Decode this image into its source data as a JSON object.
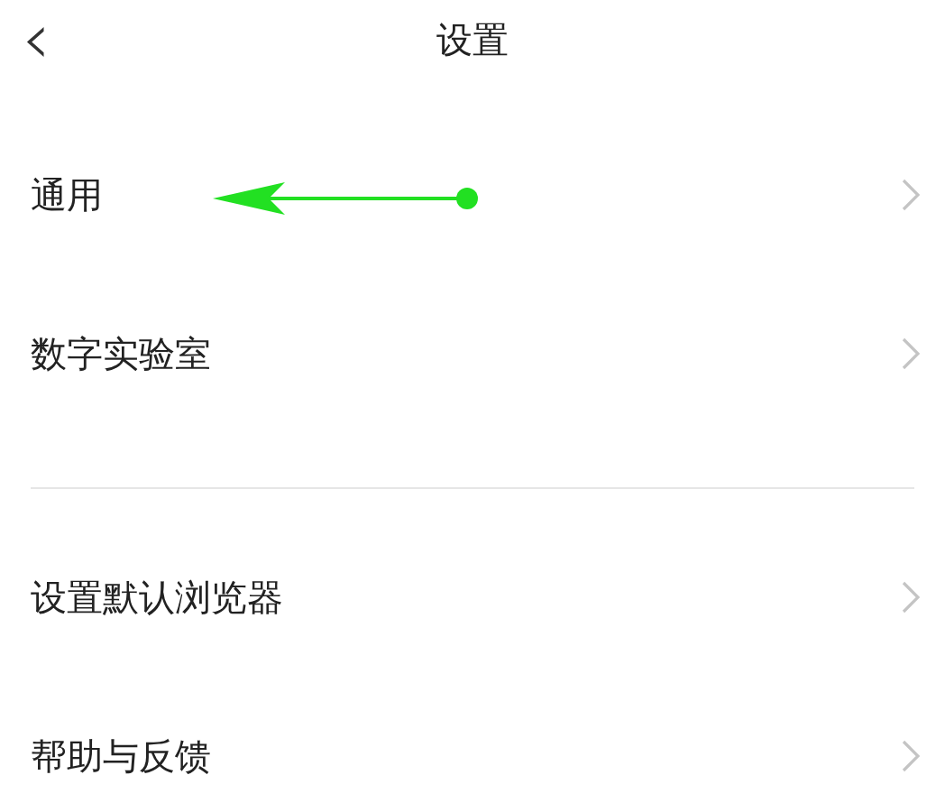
{
  "header": {
    "back": "‹",
    "title": "设置"
  },
  "groups": [
    {
      "items": [
        {
          "label": "通用"
        },
        {
          "label": "数字实验室"
        }
      ]
    },
    {
      "items": [
        {
          "label": "设置默认浏览器"
        },
        {
          "label": "帮助与反馈"
        }
      ]
    }
  ]
}
